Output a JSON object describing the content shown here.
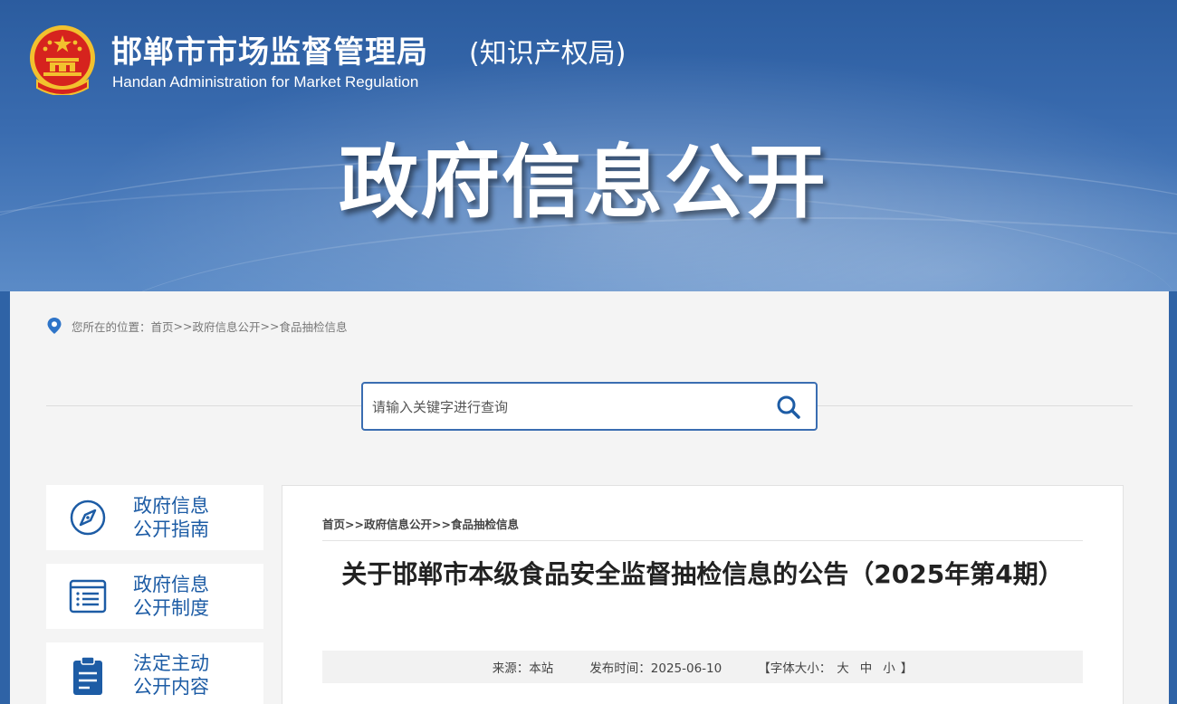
{
  "header": {
    "site_name": "邯郸市市场监督管理局",
    "site_sub": "(知识产权局)",
    "site_en": "Handan Administration for Market Regulation",
    "page_title": "政府信息公开"
  },
  "location": {
    "prefix": "您所在的位置：",
    "items": [
      "首页",
      "政府信息公开",
      "食品抽检信息"
    ],
    "separator": ">>"
  },
  "search": {
    "placeholder": "请输入关键字进行查询"
  },
  "sidebar": {
    "items": [
      {
        "line1": "政府信息",
        "line2": "公开指南",
        "icon": "compass-icon"
      },
      {
        "line1": "政府信息",
        "line2": "公开制度",
        "icon": "document-list-icon"
      },
      {
        "line1": "法定主动",
        "line2": "公开内容",
        "icon": "clipboard-icon"
      }
    ]
  },
  "article": {
    "breadcrumb": [
      "首页",
      "政府信息公开",
      "食品抽检信息"
    ],
    "breadcrumb_sep": ">>",
    "title": "关于邯郸市本级食品安全监督抽检信息的公告（2025年第4期）",
    "meta": {
      "source": "来源：本站",
      "date": "发布时间：2025-06-10",
      "font_size_label": "【字体大小：",
      "font_large": "大",
      "font_medium": "中",
      "font_small": "小",
      "font_size_end": "】"
    }
  },
  "colors": {
    "banner_blue": "#3a6cb0",
    "link_blue": "#1d5ca5",
    "emblem_red": "#d6231e",
    "emblem_gold": "#f2c12e"
  }
}
